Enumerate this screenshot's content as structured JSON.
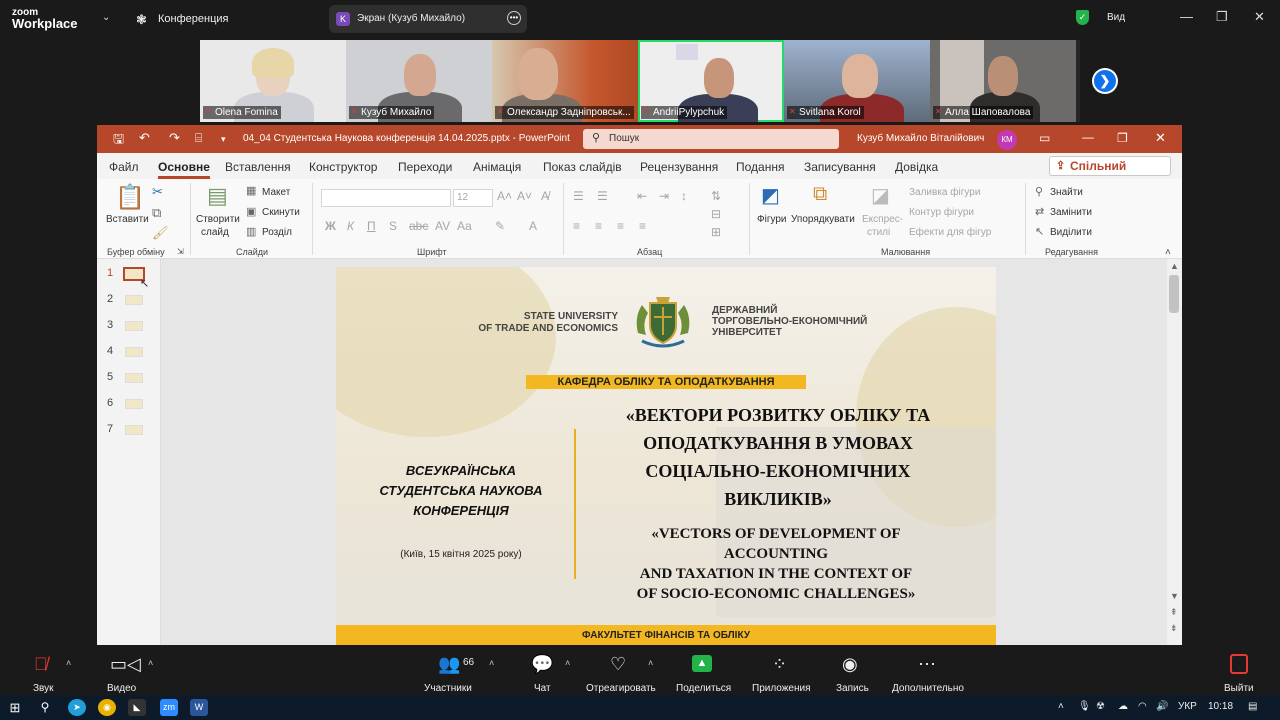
{
  "zoom": {
    "logo_line1": "zoom",
    "logo_line2": "Workplace",
    "meeting_title": "Конференция",
    "screen_share_avatar": "K",
    "screen_share_label": "Экран (Кузуб Михайло)",
    "view_label": "Вид",
    "window_controls": {
      "minimize": "—",
      "restore": "❐",
      "close": "✕"
    },
    "participants": [
      {
        "name": "Olena Fomina"
      },
      {
        "name": "Кузуб Михайло"
      },
      {
        "name": "Олександр Задніпровськ..."
      },
      {
        "name": "AndriiPylypchuk"
      },
      {
        "name": "Svitlana Korol"
      },
      {
        "name": "Алла Шаповалова"
      }
    ],
    "next_icon": "❯",
    "toolbar": {
      "audio": "Звук",
      "video": "Видео",
      "participants": "Участники",
      "participants_count": "66",
      "chat": "Чат",
      "react": "Отреагировать",
      "share": "Поделиться",
      "apps": "Приложения",
      "record": "Запись",
      "more": "Дополнительно",
      "leave": "Выйти"
    }
  },
  "powerpoint": {
    "file_title": "04_04 Студентська Наукова конференція 14.04.2025.pptx  -  PowerPoint",
    "search_placeholder": "Пошук",
    "user_name": "Кузуб Михайло Віталійович",
    "user_initials": "КМ",
    "menu": [
      "Файл",
      "Основне",
      "Вставлення",
      "Конструктор",
      "Переходи",
      "Анімація",
      "Показ слайдів",
      "Рецензування",
      "Подання",
      "Записування",
      "Довідка"
    ],
    "share_button": "Спільний доступ",
    "ribbon": {
      "paste": "Вставити",
      "clipboard_group": "Буфер обміну",
      "new_slide_1": "Створити",
      "new_slide_2": "слайд",
      "layout": "Макет",
      "reset": "Скинути",
      "section": "Розділ",
      "slides_group": "Слайди",
      "font_size": "12",
      "font_group": "Шрифт",
      "paragraph_group": "Абзац",
      "shapes": "Фігури",
      "arrange": "Упорядкувати",
      "quick_styles_1": "Експрес-",
      "quick_styles_2": "стилі",
      "shape_fill": "Заливка фігури",
      "shape_outline": "Контур фігури",
      "shape_effects": "Ефекти для фігур",
      "drawing_group": "Малювання",
      "find": "Знайти",
      "replace": "Замінити",
      "select": "Виділити",
      "editing_group": "Редагування"
    },
    "slide_numbers": [
      "1",
      "2",
      "3",
      "4",
      "5",
      "6",
      "7"
    ]
  },
  "slide": {
    "uni_en_1": "STATE UNIVERSITY",
    "uni_en_2": "OF TRADE AND ECONOMICS",
    "uni_ua_1": "ДЕРЖАВНИЙ",
    "uni_ua_2": "ТОРГОВЕЛЬНО-ЕКОНОМІЧНИЙ",
    "uni_ua_3": "УНІВЕРСИТЕТ",
    "department": "КАФЕДРА ОБЛІКУ ТА ОПОДАТКУВАННЯ",
    "left_title_1": "ВСЕУКРАЇНСЬКА",
    "left_title_2": "СТУДЕНТСЬКА НАУКОВА",
    "left_title_3": "КОНФЕРЕНЦІЯ",
    "date": "(Київ, 15 квітня 2025 року)",
    "ua_title_1": "«ВЕКТОРИ РОЗВИТКУ ОБЛІКУ ТА",
    "ua_title_2": "ОПОДАТКУВАННЯ В УМОВАХ",
    "ua_title_3": "СОЦІАЛЬНО-ЕКОНОМІЧНИХ",
    "ua_title_4": "ВИКЛИКІВ»",
    "en_title_1": "«VECTORS OF DEVELOPMENT OF",
    "en_title_2": "ACCOUNTING",
    "en_title_3": "AND TAXATION IN THE CONTEXT OF",
    "en_title_4": "OF SOCIO-ECONOMIC CHALLENGES»",
    "faculty": "ФАКУЛЬТЕТ ФІНАНСІВ ТА ОБЛІКУ"
  },
  "taskbar": {
    "lang": "УКР",
    "time": "10:18"
  }
}
